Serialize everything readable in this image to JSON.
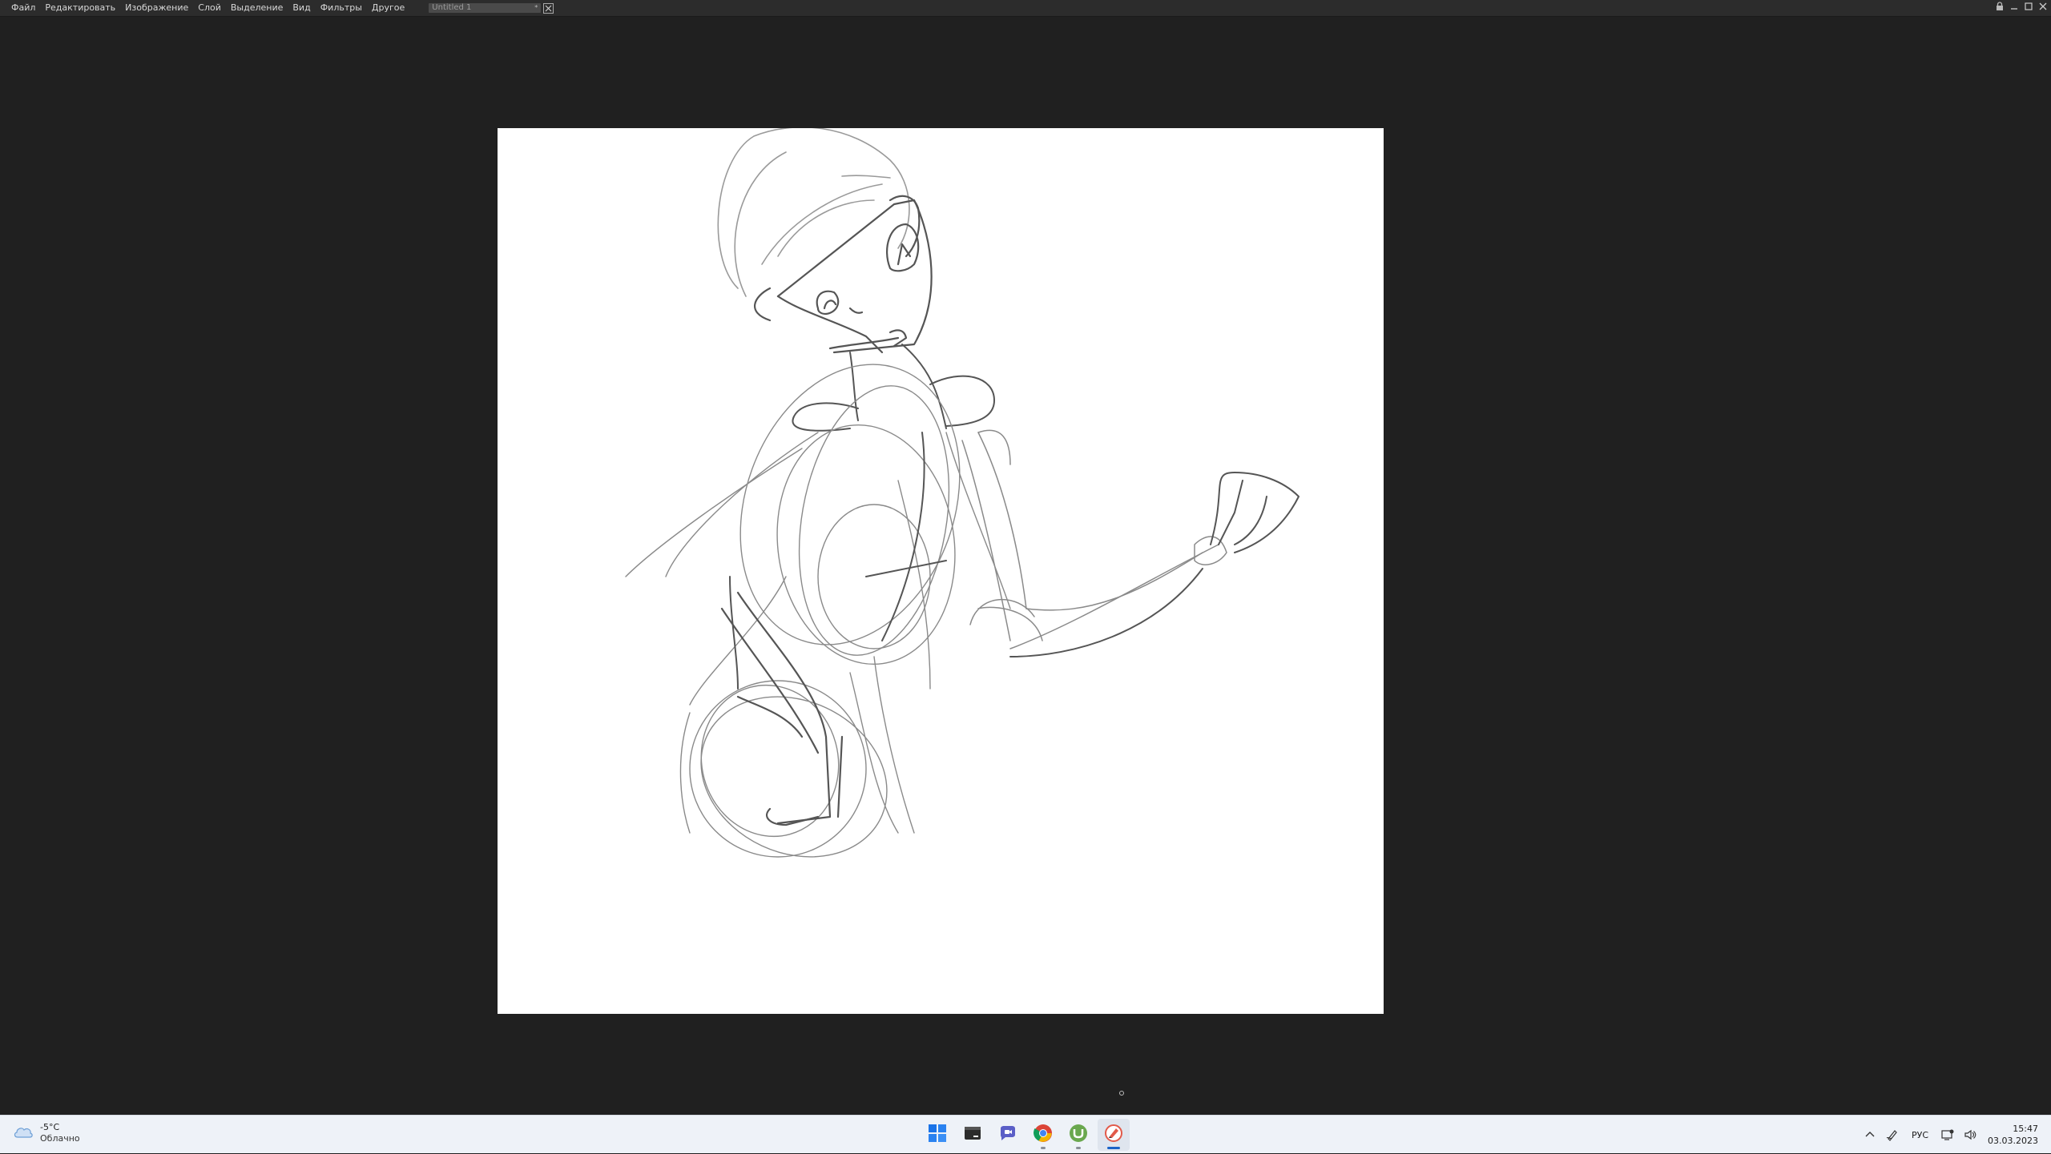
{
  "menu": {
    "items": [
      {
        "label": "Файл"
      },
      {
        "label": "Редактировать"
      },
      {
        "label": "Изображение"
      },
      {
        "label": "Слой"
      },
      {
        "label": "Выделение"
      },
      {
        "label": "Вид"
      },
      {
        "label": "Фильтры"
      },
      {
        "label": "Другое"
      }
    ]
  },
  "document": {
    "tab_title": "Untitled 1",
    "modified_marker": "*"
  },
  "window_controls": [
    "lock-icon",
    "minimize-icon",
    "maximize-icon",
    "close-icon"
  ],
  "canvas": {
    "background": "#ffffff",
    "content": "pencil sketch"
  },
  "taskbar": {
    "weather": {
      "temp": "-5°C",
      "desc": "Облачно",
      "icon": "cloud-icon"
    },
    "apps": [
      {
        "name": "windows-start-icon",
        "running": false
      },
      {
        "name": "terminal-icon",
        "running": false
      },
      {
        "name": "teams-chat-icon",
        "running": false
      },
      {
        "name": "chrome-icon",
        "running": true
      },
      {
        "name": "utorrent-icon",
        "running": true
      },
      {
        "name": "paint-app-icon",
        "running": true,
        "active": true
      }
    ],
    "tray": {
      "language": "РУС",
      "time": "15:47",
      "date": "03.03.2023"
    }
  }
}
